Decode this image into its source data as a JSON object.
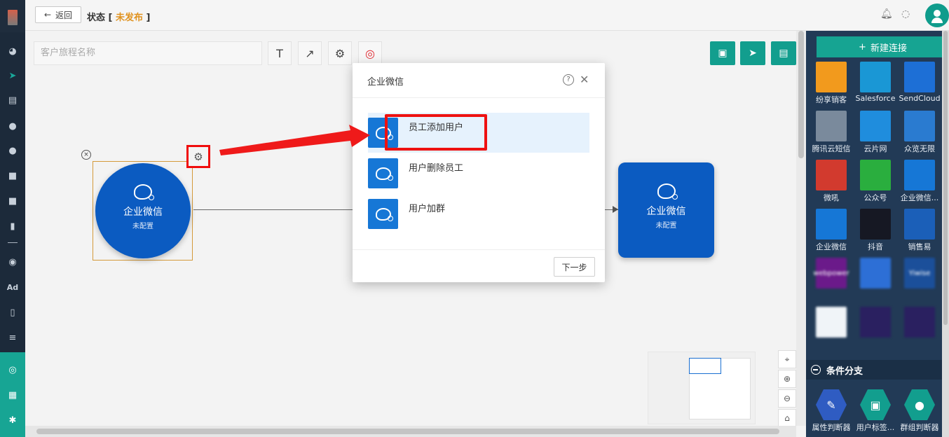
{
  "topbar": {
    "back_label": "返回",
    "status_label": "状态 [",
    "status_value": "未发布",
    "status_close": "]"
  },
  "nav": {
    "items": [
      "dashboard-icon",
      "send-icon",
      "layout-icon",
      "user-icon",
      "users-icon",
      "square-icon",
      "square-icon",
      "bar-chart-icon",
      "dash-icon",
      "wechat-icon",
      "ad-text",
      "tag-icon",
      "list-icon"
    ],
    "ad_label": "Ad",
    "bottom_items": [
      "hub-icon",
      "server-icon",
      "settings-icon"
    ]
  },
  "canvas": {
    "journey_name_placeholder": "客户旅程名称",
    "tools": [
      "text-tool-icon",
      "arrow-tool-icon",
      "gear-tool-icon",
      "target-tool-icon"
    ],
    "action_buttons": [
      "save-icon",
      "publish-icon",
      "layout-icon"
    ],
    "nodes": [
      {
        "title": "企业微信",
        "subtitle": "未配置",
        "shape": "circle"
      },
      {
        "title": "企业微信",
        "subtitle": "未配置",
        "shape": "square"
      }
    ]
  },
  "modal": {
    "title": "企业微信",
    "options": [
      {
        "label": "员工添加用户",
        "selected": true
      },
      {
        "label": "用户删除员工",
        "selected": false
      },
      {
        "label": "用户加群",
        "selected": false
      }
    ],
    "next_label": "下一步"
  },
  "right_panel": {
    "new_connection_label": "新建连接",
    "tiles": [
      {
        "label": "纷享销客",
        "color": "#f29a1d"
      },
      {
        "label": "Salesforce",
        "color": "#1a97d5"
      },
      {
        "label": "SendCloud",
        "color": "#1d6fd6"
      },
      {
        "label": "腾讯云短信",
        "color": "#7a8a9c"
      },
      {
        "label": "云片网",
        "color": "#1f8ddd"
      },
      {
        "label": "众览无限",
        "color": "#2a7bd0"
      },
      {
        "label": "微吼",
        "color": "#d23a2e"
      },
      {
        "label": "公众号",
        "color": "#2aae3e"
      },
      {
        "label": "企业微信...",
        "color": "#1677d6"
      },
      {
        "label": "企业微信",
        "color": "#1677d6"
      },
      {
        "label": "抖音",
        "color": "#161823"
      },
      {
        "label": "销售易",
        "color": "#1b5fb8"
      },
      {
        "label": "",
        "color": "#6b1a8a",
        "box_text": "webpower"
      },
      {
        "label": "",
        "color": "#2d6fd6"
      },
      {
        "label": "",
        "color": "#1b4f9a",
        "box_text": "Yiwise"
      },
      {
        "label": "",
        "color": "#f0f4f8"
      },
      {
        "label": "",
        "color": "#2a2060"
      },
      {
        "label": "",
        "color": "#2a2060"
      }
    ],
    "section_title": "条件分支",
    "branch_tiles": [
      {
        "label": "属性判断器"
      },
      {
        "label": "用户标签..."
      },
      {
        "label": "群组判断器"
      }
    ]
  },
  "colors": {
    "accent_green": "#129e8e",
    "node_blue": "#0b5bc1",
    "status_orange": "#e0921e",
    "highlight_red": "#ee1111"
  }
}
